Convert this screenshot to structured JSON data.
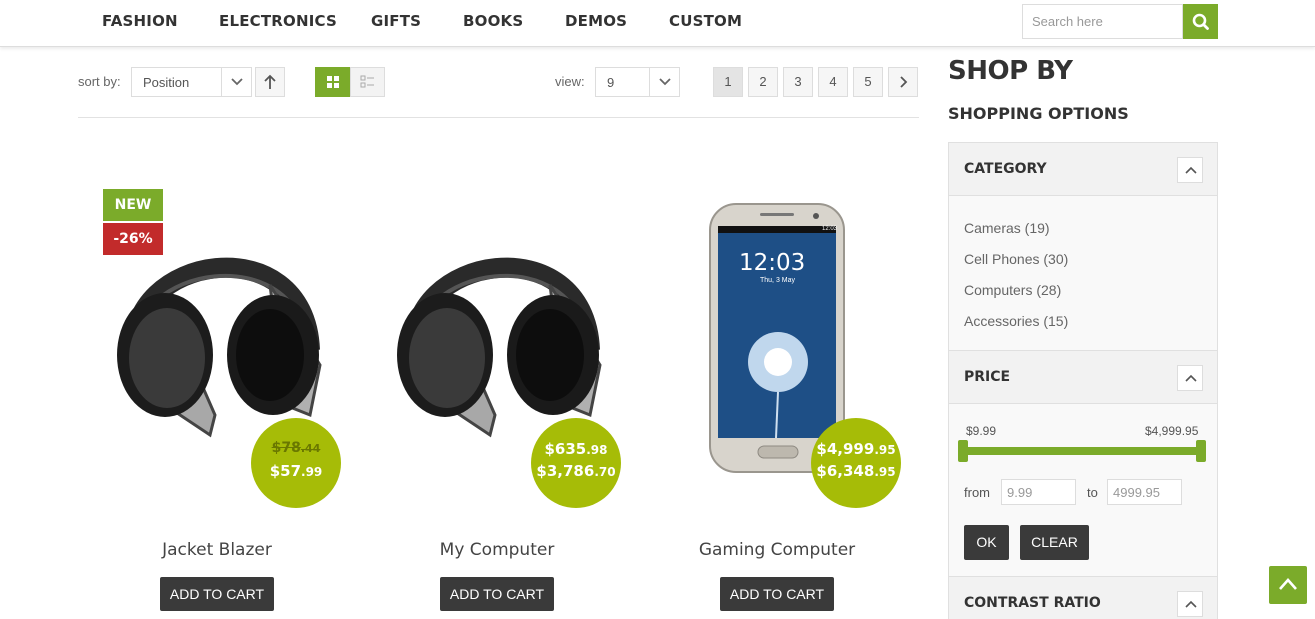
{
  "nav": {
    "items": [
      "FASHION",
      "ELECTRONICS",
      "GIFTS",
      "BOOKS",
      "DEMOS",
      "CUSTOM"
    ],
    "search_placeholder": "Search here",
    "search_icon": "search-icon"
  },
  "toolbar": {
    "sort_label": "sort by:",
    "sort_value": "Position",
    "view_label": "view:",
    "view_value": "9",
    "pages": [
      "1",
      "2",
      "3",
      "4",
      "5"
    ],
    "active_page": "1"
  },
  "products": [
    {
      "name": "Jacket Blazer",
      "badge_new": "NEW",
      "badge_sale": "-26%",
      "old_price_main": "$78",
      "old_price_cents": ".44",
      "price_main": "$57",
      "price_cents": ".99",
      "cart_label": "ADD TO CART",
      "image": "headphones"
    },
    {
      "name": "My Computer",
      "price_main": "$635",
      "price_cents": ".98",
      "price2_main": "$3,786",
      "price2_cents": ".70",
      "cart_label": "ADD TO CART",
      "image": "headphones"
    },
    {
      "name": "Gaming Computer",
      "price_main": "$4,999",
      "price_cents": ".95",
      "price2_main": "$6,348",
      "price2_cents": ".95",
      "cart_label": "ADD TO CART",
      "image": "smartphone",
      "phone_time": "12:03",
      "phone_date": "Thu, 3 May",
      "phone_status_time": "12:03"
    }
  ],
  "sidebar": {
    "title": "SHOP BY",
    "subtitle": "SHOPPING OPTIONS",
    "category": {
      "title": "CATEGORY",
      "items": [
        "Cameras (19)",
        "Cell Phones (30)",
        "Computers (28)",
        "Accessories (15)"
      ]
    },
    "price": {
      "title": "PRICE",
      "min_label": "$9.99",
      "max_label": "$4,999.95",
      "from_label": "from",
      "to_label": "to",
      "from_value": "9.99",
      "to_value": "4999.95",
      "ok_label": "OK",
      "clear_label": "CLEAR"
    },
    "contrast": {
      "title": "CONTRAST RATIO"
    }
  },
  "colors": {
    "accent": "#7bab2a",
    "price_circle": "#a6bc07",
    "sale": "#c22b2b",
    "button_dark": "#3a3a3a"
  }
}
